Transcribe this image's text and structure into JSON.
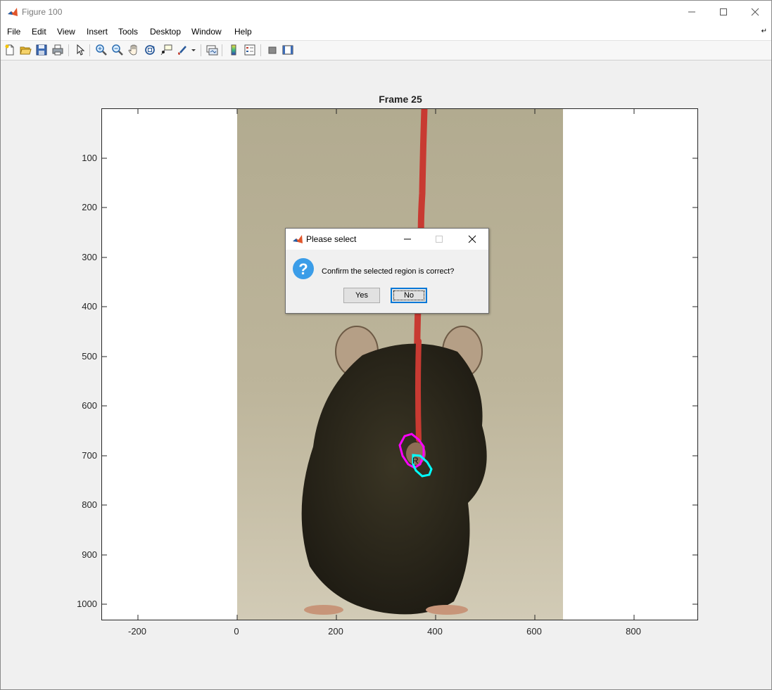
{
  "window": {
    "title": "Figure 100"
  },
  "menu": [
    "File",
    "Edit",
    "View",
    "Insert",
    "Tools",
    "Desktop",
    "Window",
    "Help"
  ],
  "toolbar_icons": [
    "new-figure-icon",
    "open-file-icon",
    "save-icon",
    "print-icon",
    "pointer-icon",
    "zoom-in-icon",
    "zoom-out-icon",
    "pan-icon",
    "rotate-3d-icon",
    "data-cursor-icon",
    "brush-icon",
    "link-plot-icon",
    "insert-colorbar-icon",
    "insert-legend-icon",
    "hide-plot-tools-icon",
    "show-plot-tools-icon"
  ],
  "plot": {
    "title": "Frame 25",
    "x_ticks": [
      "-200",
      "0",
      "200",
      "400",
      "600",
      "800"
    ],
    "y_ticks": [
      "100",
      "200",
      "300",
      "400",
      "500",
      "600",
      "700",
      "800",
      "900",
      "1000"
    ],
    "region_label": "R",
    "colors": {
      "roi_magenta": "#ff00ff",
      "roi_cyan": "#00ffff",
      "string": "#c83a32",
      "background": "#b5ae94"
    }
  },
  "dialog": {
    "title": "Please select",
    "message": "Confirm the selected region is correct?",
    "yes_label": "Yes",
    "no_label": "No",
    "question_icon": "?"
  }
}
